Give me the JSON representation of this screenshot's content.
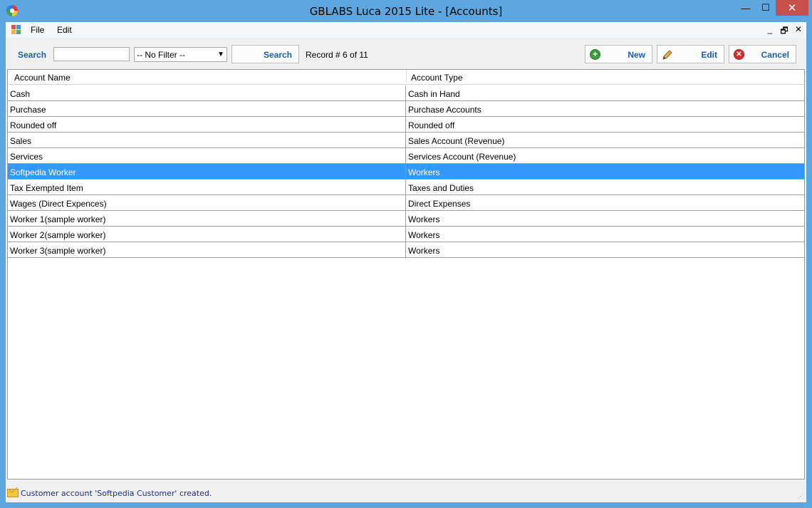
{
  "window": {
    "title": "GBLABS Luca 2015 Lite - [Accounts]",
    "minimize_glyph": "—",
    "maximize_glyph": "☐",
    "close_glyph": "✕"
  },
  "menubar": {
    "items": [
      {
        "label": "File"
      },
      {
        "label": "Edit"
      }
    ],
    "mdi_minimize": "_",
    "mdi_restore": "🗗",
    "mdi_close": "✕"
  },
  "toolbar": {
    "search_label": "Search",
    "search_value": "",
    "filter_selected": "-- No Filter --",
    "search_button": "Search",
    "record_text": "Record # 6 of 11",
    "new_button": "New",
    "edit_button": "Edit",
    "cancel_button": "Cancel"
  },
  "grid": {
    "columns": [
      "Account Name",
      "Account Type"
    ],
    "selected_index": 5,
    "rows": [
      [
        "Cash",
        "Cash in Hand"
      ],
      [
        "Purchase",
        "Purchase Accounts"
      ],
      [
        "Rounded off",
        "Rounded off"
      ],
      [
        "Sales",
        "Sales Account (Revenue)"
      ],
      [
        "Services",
        "Services Account (Revenue)"
      ],
      [
        "Softpedia Worker",
        "Workers"
      ],
      [
        "Tax Exempted Item",
        "Taxes and Duties"
      ],
      [
        "Wages (Direct Expences)",
        "Direct Expenses"
      ],
      [
        "Worker 1(sample worker)",
        "Workers"
      ],
      [
        "Worker 2(sample worker)",
        "Workers"
      ],
      [
        "Worker 3(sample worker)",
        "Workers"
      ]
    ]
  },
  "status": {
    "message": "Customer account 'Softpedia Customer' created."
  },
  "colors": {
    "title_bar": "#5ea6e0",
    "accent_text": "#1a5fb4",
    "selection": "#3399ff",
    "close_button": "#c7504b"
  }
}
